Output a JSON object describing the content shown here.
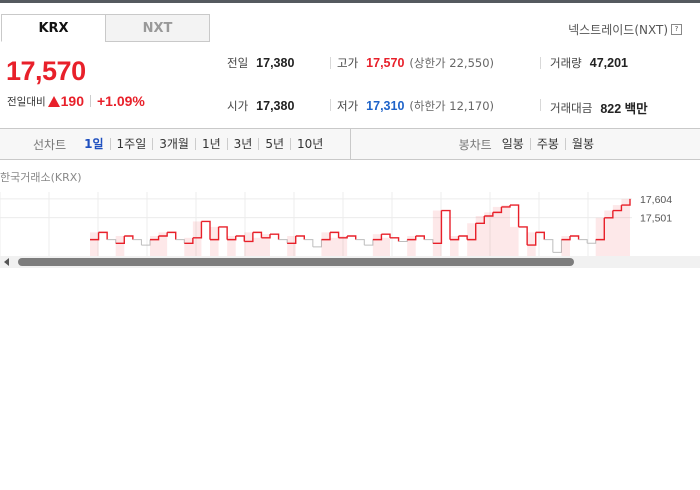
{
  "tabs": [
    "KRX",
    "NXT"
  ],
  "nxt_link": "넥스트레이드(NXT)",
  "nxt_help_icon": "?",
  "price": "17,570",
  "change": {
    "label": "전일대비",
    "direction_icon": "up-triangle-icon",
    "value": "190",
    "percent": "+1.09%"
  },
  "stats": {
    "prev_close": {
      "label": "전일",
      "value": "17,380"
    },
    "open": {
      "label": "시가",
      "value": "17,380"
    },
    "high": {
      "label": "고가",
      "value": "17,570",
      "sub": "(상한가 22,550)"
    },
    "low": {
      "label": "저가",
      "value": "17,310",
      "sub": "(하한가 12,170)"
    },
    "volume": {
      "label": "거래량",
      "value": "47,201"
    },
    "trade_value": {
      "label": "거래대금",
      "value": "822 백만"
    }
  },
  "line_chart_toolbar": {
    "title": "선차트",
    "items": [
      "1일",
      "1주일",
      "3개월",
      "1년",
      "3년",
      "5년",
      "10년"
    ],
    "selected": "1일"
  },
  "candle_chart_toolbar": {
    "title": "봉차트",
    "items": [
      "일봉",
      "주봉",
      "월봉"
    ]
  },
  "chart_section_label": "한국거래소(KRX)",
  "colors": {
    "up": "#e8202a",
    "down": "#1e63c9",
    "selected": "#1e4fbf"
  },
  "chart_data": {
    "type": "line",
    "title": "",
    "xlabel": "",
    "ylabel": "",
    "y_tick_labels": [
      "17,604",
      "17,501"
    ],
    "series": [
      {
        "values": [
          17380,
          17420,
          17380,
          17360,
          17400,
          17380,
          17350,
          17380,
          17400,
          17420,
          17380,
          17360,
          17390,
          17480,
          17380,
          17450,
          17380,
          17400,
          17370,
          17420,
          17390,
          17410,
          17380,
          17360,
          17400,
          17380,
          17340,
          17380,
          17420,
          17390,
          17400,
          17380,
          17350,
          17380,
          17410,
          17390,
          17370,
          17380,
          17400,
          17380,
          17360,
          17540,
          17380,
          17400,
          17380,
          17470,
          17510,
          17530,
          17560,
          17570,
          17450,
          17350,
          17420,
          17380,
          17310,
          17380,
          17400,
          17380,
          17360,
          17380,
          17500,
          17540,
          17570,
          17604
        ]
      }
    ]
  }
}
